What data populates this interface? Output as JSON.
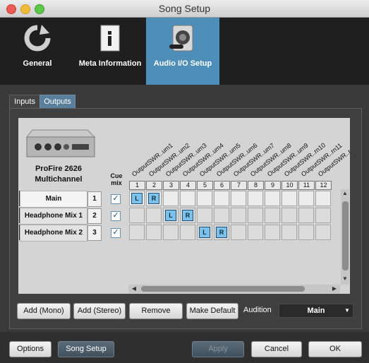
{
  "window": {
    "title": "Song Setup"
  },
  "toolbar": {
    "items": [
      {
        "label": "General",
        "icon": "refresh-icon"
      },
      {
        "label": "Meta Information",
        "icon": "document-info-icon"
      },
      {
        "label": "Audio I/O Setup",
        "icon": "speaker-icon",
        "selected": true
      }
    ]
  },
  "tabs": {
    "inputs": "Inputs",
    "outputs": "Outputs",
    "selected": "Outputs"
  },
  "device": {
    "name_line1": "ProFire 2626",
    "name_line2": "Multichannel"
  },
  "matrix": {
    "cue_label_1": "Cue",
    "cue_label_2": "mix",
    "columns": [
      "OutputSWR..um1",
      "OutputSWR..um2",
      "OutputSWR..um3",
      "OutputSWR..um4",
      "OutputSWR..um5",
      "OutputSWR..um6",
      "OutputSWR..um7",
      "OutputSWR..um8",
      "OutputSWR..um9",
      "OutputSWR..rn10",
      "OutputSWR..rn11",
      "OutputSWR..r"
    ],
    "column_numbers": [
      "1",
      "2",
      "3",
      "4",
      "5",
      "6",
      "7",
      "8",
      "9",
      "10",
      "11",
      "12",
      "1"
    ],
    "rows": [
      {
        "label": "Main",
        "number": "1",
        "cue": true,
        "assign": {
          "0": "L",
          "1": "R"
        }
      },
      {
        "label": "Headphone Mix 1",
        "number": "2",
        "cue": true,
        "assign": {
          "2": "L",
          "3": "R"
        }
      },
      {
        "label": "Headphone Mix 2",
        "number": "3",
        "cue": true,
        "assign": {
          "4": "L",
          "5": "R"
        }
      }
    ],
    "check_glyph": "✓"
  },
  "buttons": {
    "add_mono": "Add (Mono)",
    "add_stereo": "Add (Stereo)",
    "remove": "Remove",
    "make_default": "Make Default"
  },
  "audition": {
    "label": "Audition",
    "value": "Main"
  },
  "footer": {
    "options": "Options",
    "song_setup": "Song Setup",
    "apply": "Apply",
    "cancel": "Cancel",
    "ok": "OK"
  },
  "colors": {
    "accent": "#4d8fb8",
    "pill": "#7cc2ea",
    "toolbar_bg": "#1f1f1f"
  }
}
